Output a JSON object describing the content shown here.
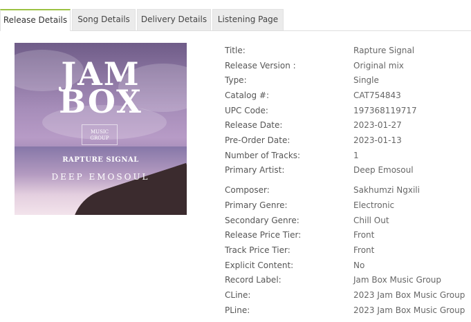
{
  "tabs": [
    {
      "label": "Release Details"
    },
    {
      "label": "Song Details"
    },
    {
      "label": "Delivery Details"
    },
    {
      "label": "Listening Page"
    }
  ],
  "cover": {
    "line1": "JAM",
    "line2": "BOX",
    "badge_top": "MUSIC",
    "badge_bottom": "GROUP",
    "title": "RAPTURE SIGNAL",
    "artist": "DEEP EMOSOUL"
  },
  "details": [
    {
      "label": "Title:",
      "value": "Rapture Signal"
    },
    {
      "label": "Release Version :",
      "value": "Original mix"
    },
    {
      "label": "Type:",
      "value": "Single"
    },
    {
      "label": "Catalog #:",
      "value": "CAT754843"
    },
    {
      "label": "UPC Code:",
      "value": "197368119717"
    },
    {
      "label": "Release Date:",
      "value": "2023-01-27"
    },
    {
      "label": "Pre-Order Date:",
      "value": "2023-01-13"
    },
    {
      "label": "Number of Tracks:",
      "value": "1"
    },
    {
      "label": "Primary Artist:",
      "value": "Deep Emosoul"
    },
    {
      "label": "Composer:",
      "value": "Sakhumzi Ngxili"
    },
    {
      "label": "Primary Genre:",
      "value": "Electronic"
    },
    {
      "label": "Secondary Genre:",
      "value": "Chill Out"
    },
    {
      "label": "Release Price Tier:",
      "value": "Front"
    },
    {
      "label": "Track Price Tier:",
      "value": "Front"
    },
    {
      "label": "Explicit Content:",
      "value": "No"
    },
    {
      "label": "Record Label:",
      "value": "Jam Box Music Group"
    },
    {
      "label": "CLine:",
      "value": "2023 Jam Box Music Group"
    },
    {
      "label": "PLine:",
      "value": "2023 Jam Box Music Group"
    }
  ],
  "colors": {
    "active_tab_accent": "#9cc243",
    "tab_bg": "#ebebeb"
  }
}
